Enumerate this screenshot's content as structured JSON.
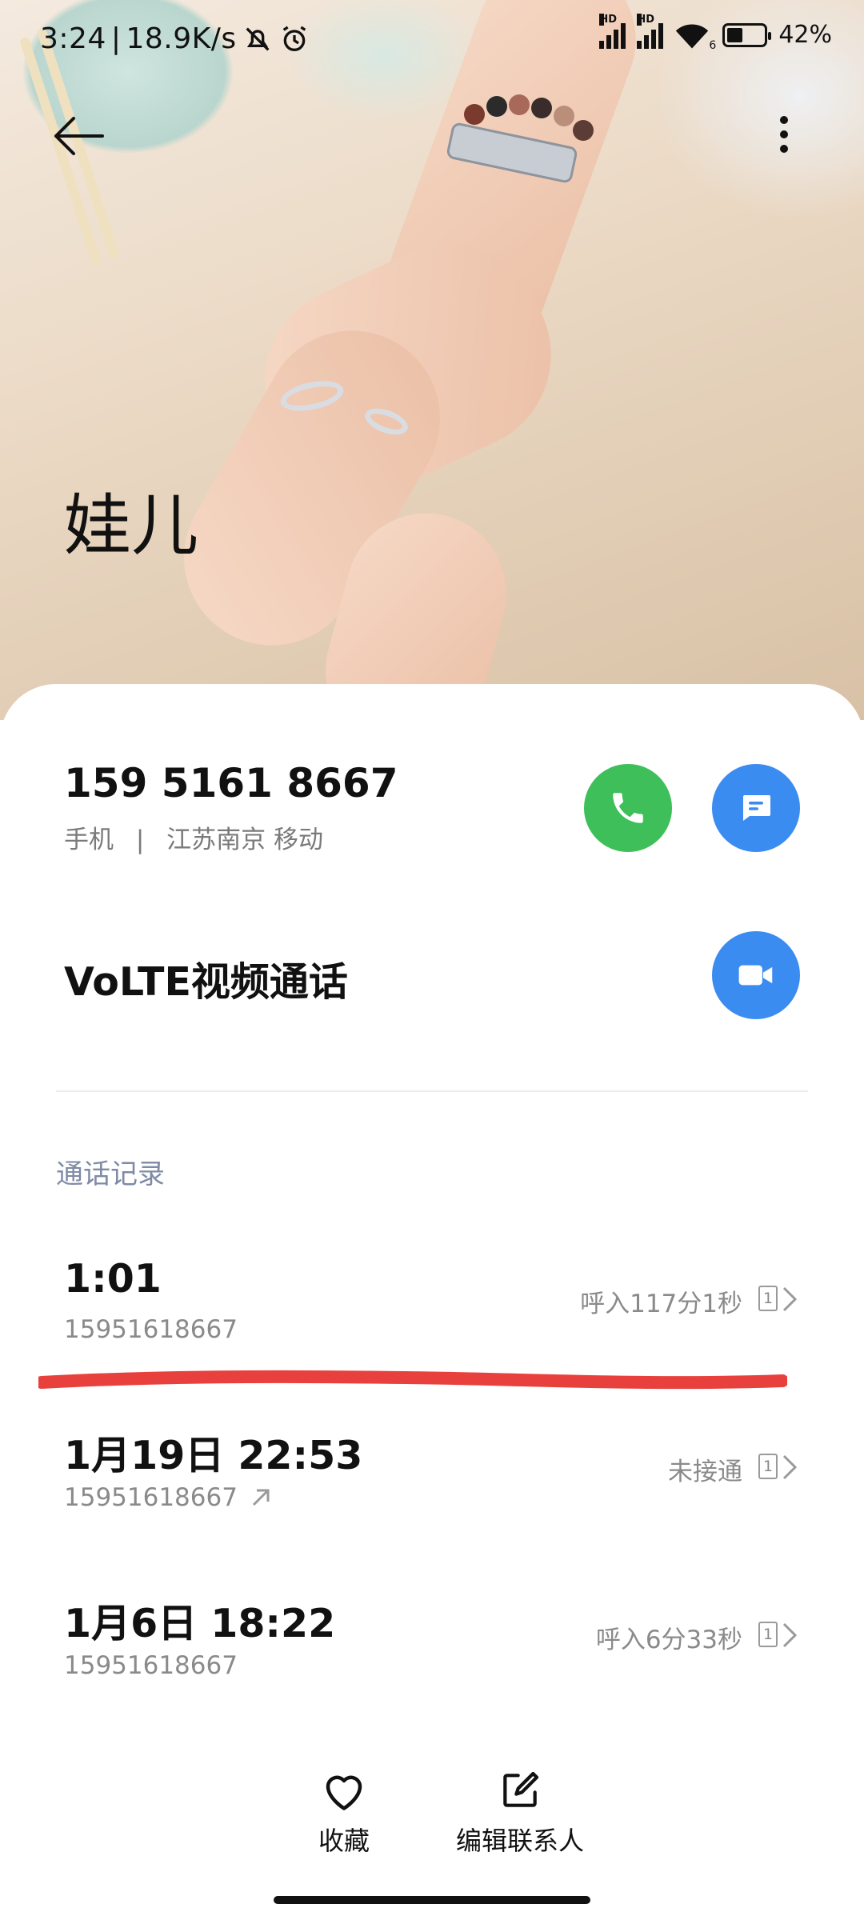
{
  "status_bar": {
    "time": "3:24",
    "separator": "|",
    "net_speed": "18.9K/s",
    "sim1_tag": "HD",
    "sim2_tag": "HD",
    "wifi_gen": "6",
    "battery": "42%",
    "battery_level": 0.42
  },
  "contact": {
    "name": "娃儿",
    "phone": "159 5161 8667",
    "phone_type": "手机",
    "meta_sep": "|",
    "location": "江苏南京 移动"
  },
  "actions": {
    "volte_label": "VoLTE视频通话"
  },
  "call_log": {
    "title": "通话记录",
    "items": [
      {
        "time": "1:01",
        "number": "15951618667",
        "status": "呼入117分1秒",
        "sim": "1",
        "outgoing": false
      },
      {
        "time": "1月19日 22:53",
        "number": "15951618667",
        "status": "未接通",
        "sim": "1",
        "outgoing": true
      },
      {
        "time": "1月6日 18:22",
        "number": "15951618667",
        "status": "呼入6分33秒",
        "sim": "1",
        "outgoing": false
      }
    ]
  },
  "bottom_bar": {
    "favorite_label": "收藏",
    "edit_label": "编辑联系人"
  },
  "colors": {
    "call_green": "#3ebf5a",
    "accent_blue": "#3b8cf0",
    "annotation_red": "#e8403c",
    "section_title": "#7f8aa6"
  },
  "icons": [
    "back-arrow-icon",
    "more-vert-icon",
    "phone-icon",
    "message-icon",
    "video-camera-icon",
    "heart-icon",
    "edit-icon",
    "chevron-right-icon",
    "outgoing-call-arrow-icon"
  ]
}
